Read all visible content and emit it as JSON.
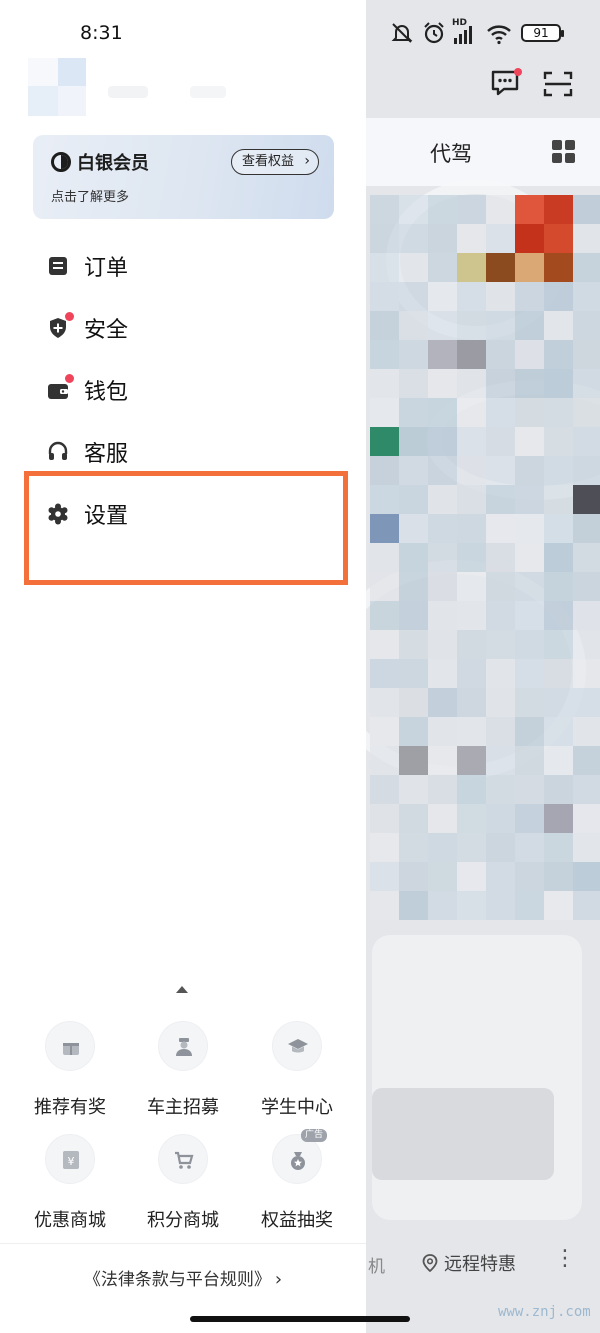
{
  "status_bar": {
    "time": "8:31",
    "battery": "91",
    "network_label": "HD"
  },
  "map": {
    "tab_label": "代驾",
    "bottom_partial": "机",
    "remote_label": "远程特惠",
    "more": "⋮",
    "watermark": "www.znj.com"
  },
  "member": {
    "title": "白银会员",
    "subtitle": "点击了解更多",
    "rights_button": "查看权益",
    "rights_chevron": "›"
  },
  "menu": [
    {
      "id": "orders",
      "label": "订单",
      "icon": "order-list-icon",
      "badge": false
    },
    {
      "id": "security",
      "label": "安全",
      "icon": "shield-plus-icon",
      "badge": true
    },
    {
      "id": "wallet",
      "label": "钱包",
      "icon": "wallet-icon",
      "badge": true
    },
    {
      "id": "service",
      "label": "客服",
      "icon": "headset-icon",
      "badge": false
    },
    {
      "id": "settings",
      "label": "设置",
      "icon": "gear-icon",
      "badge": false
    }
  ],
  "shortcuts": [
    {
      "label": "推荐有奖",
      "icon": "gift-icon"
    },
    {
      "label": "车主招募",
      "icon": "driver-icon"
    },
    {
      "label": "学生中心",
      "icon": "graduation-cap-icon"
    },
    {
      "label": "优惠商城",
      "icon": "yen-coupon-icon"
    },
    {
      "label": "积分商城",
      "icon": "cart-icon"
    },
    {
      "label": "权益抽奖",
      "icon": "lottery-bag-icon",
      "tag": "广告"
    }
  ],
  "footer": {
    "legal_link": "《法律条款与平台规则》",
    "legal_arrow": "›"
  },
  "colors": {
    "highlight": "#f4703a",
    "badge": "#f0445b",
    "member_gradient_end": "#cfdcee"
  }
}
